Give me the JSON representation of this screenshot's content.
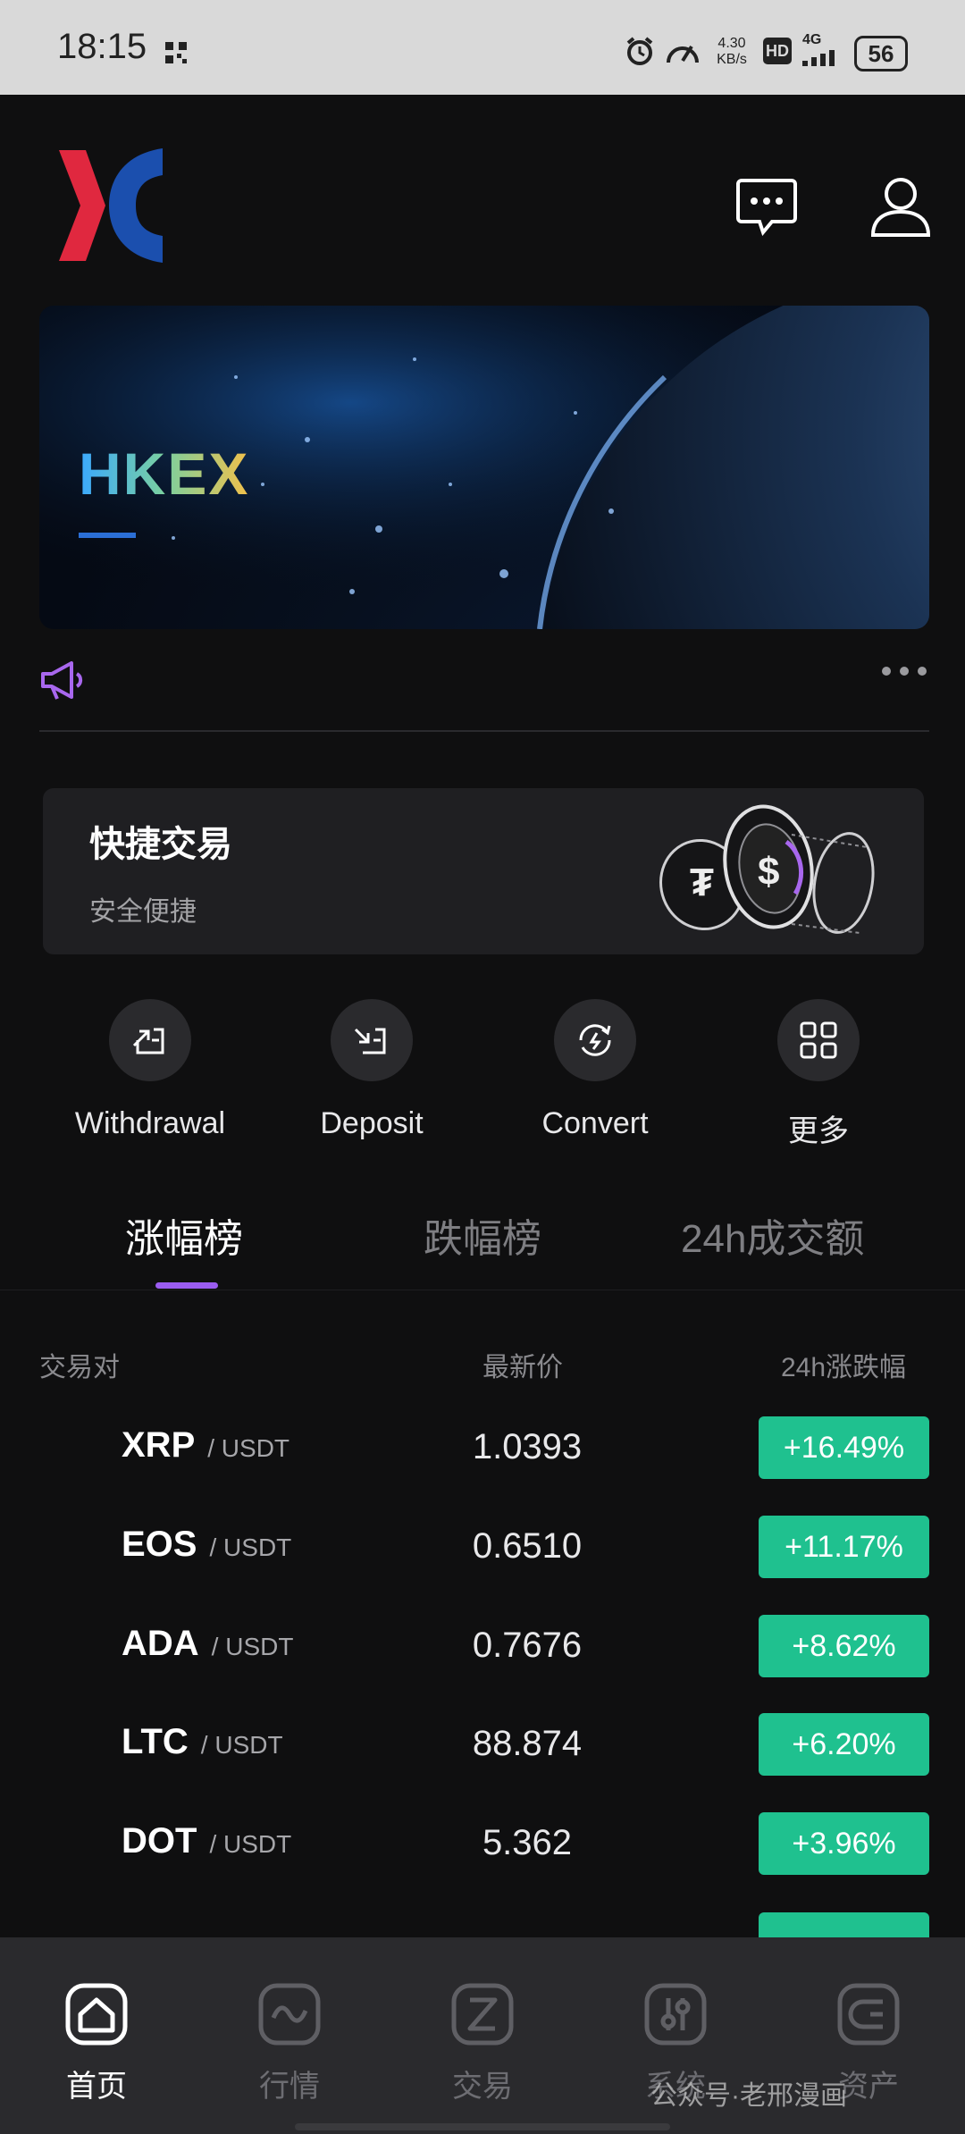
{
  "status_bar": {
    "time": "18:15",
    "net_speed": "4.30",
    "net_unit": "KB/s",
    "hd": "HD",
    "network": "4G",
    "battery": "56"
  },
  "header": {
    "logo_icon": "hkex-logo",
    "message_icon": "chat-icon",
    "profile_icon": "user-icon"
  },
  "banner": {
    "brand": "HKEX",
    "brand_colors": [
      "#3aa8ff",
      "#7ad0a0",
      "#f2c04a"
    ]
  },
  "announcement": {
    "icon": "megaphone-icon",
    "more_icon": "more-horizontal-icon"
  },
  "quick_trade": {
    "title": "快捷交易",
    "subtitle": "安全便捷"
  },
  "actions": [
    {
      "label": "Withdrawal",
      "icon": "withdraw-icon"
    },
    {
      "label": "Deposit",
      "icon": "deposit-icon"
    },
    {
      "label": "Convert",
      "icon": "convert-icon"
    },
    {
      "label": "更多",
      "icon": "grid-icon"
    }
  ],
  "tabs": [
    {
      "label": "涨幅榜",
      "active": true
    },
    {
      "label": "跌幅榜",
      "active": false
    },
    {
      "label": "24h成交额",
      "active": false
    }
  ],
  "table": {
    "headers": {
      "pair": "交易对",
      "price": "最新价",
      "change": "24h涨跌幅"
    },
    "rows": [
      {
        "base": "XRP",
        "quote": "/ USDT",
        "price": "1.0393",
        "change": "+16.49%"
      },
      {
        "base": "EOS",
        "quote": "/ USDT",
        "price": "0.6510",
        "change": "+11.17%"
      },
      {
        "base": "ADA",
        "quote": "/ USDT",
        "price": "0.7676",
        "change": "+8.62%"
      },
      {
        "base": "LTC",
        "quote": "/ USDT",
        "price": "88.874",
        "change": "+6.20%"
      },
      {
        "base": "DOT",
        "quote": "/ USDT",
        "price": "5.362",
        "change": "+3.96%"
      }
    ]
  },
  "bottom_nav": [
    {
      "label": "首页",
      "icon": "home-icon",
      "active": true
    },
    {
      "label": "行情",
      "icon": "market-icon",
      "active": false
    },
    {
      "label": "交易",
      "icon": "trade-icon",
      "active": false
    },
    {
      "label": "系统",
      "icon": "system-icon",
      "active": false
    },
    {
      "label": "资产",
      "icon": "wallet-icon",
      "active": false
    }
  ],
  "watermark": "公众号·老邢漫画",
  "colors": {
    "accent": "#9b5cf0",
    "up": "#1fc18f",
    "background": "#0f0f10"
  }
}
